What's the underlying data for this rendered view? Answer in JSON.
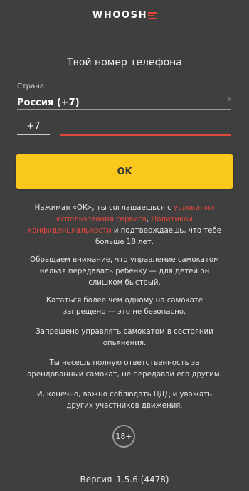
{
  "logo": {
    "text": "WHOOSH"
  },
  "screen": {
    "title": "Твой номер телефона"
  },
  "country": {
    "label": "Страна",
    "value": "Россия (+7)"
  },
  "phone": {
    "code": "+7",
    "value": "",
    "placeholder": ""
  },
  "ok_button": {
    "label": "OK"
  },
  "terms": {
    "agreement_prefix": "Нажимая «ОК», ты соглашаешься с ",
    "terms_link": "условиями использования сервиса",
    "separator": ", ",
    "privacy_link": "Политикой конфиденциальности",
    "agreement_suffix": " и подтверждаешь, что тебе больше 18 лет.",
    "notice_children": "Обращаем внимание, что управление самокатом нельзя передавать ребёнку — для детей он слишком быстрый.",
    "notice_one_rider": "Кататься более чем одному на самокате запрещено — это не безопасно.",
    "notice_intoxication": "Запрещено управлять самокатом в состоянии опьянения.",
    "notice_responsibility": "Ты несешь полную ответственность за арендованный самокат, не передавай его другим.",
    "notice_traffic_rules": "И, конечно, важно соблюдать ПДД и уважать других участников движения."
  },
  "age_badge": "18+",
  "version": {
    "label": "Версия",
    "number": "1.5.6 (4478)"
  },
  "colors": {
    "background": "#3f3f3f",
    "accent_yellow": "#f9c81a",
    "accent_red": "#e2473c"
  },
  "icons": {
    "country_chevron": "chevron-right-icon"
  }
}
